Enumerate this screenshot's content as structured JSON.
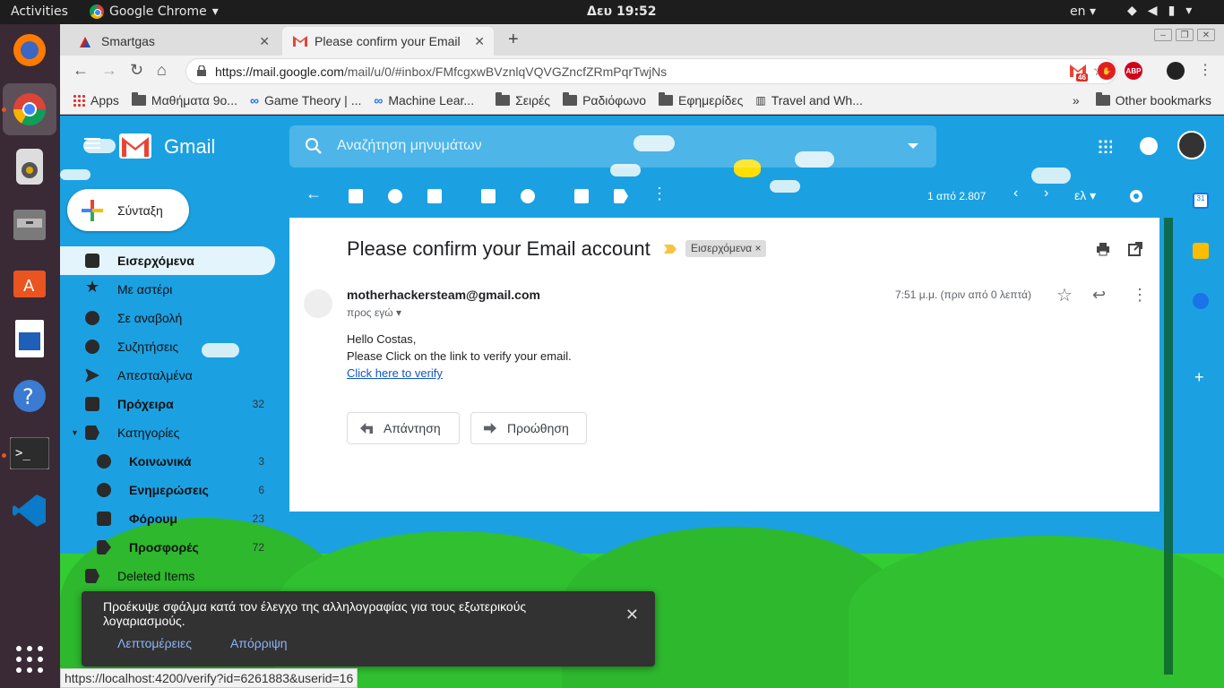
{
  "topbar": {
    "activities": "Activities",
    "app_name": "Google Chrome",
    "clock": "Δευ 19:52",
    "lang": "en"
  },
  "dock": {
    "items": [
      "firefox-icon",
      "chrome-icon",
      "speaker-icon",
      "files-icon",
      "software-icon",
      "writer-icon",
      "help-icon",
      "terminal-icon",
      "vscode-icon",
      "show-apps-icon"
    ]
  },
  "browser": {
    "tabs": [
      {
        "label": "Smartgas",
        "active": false
      },
      {
        "label": "Please confirm your Email",
        "active": true
      }
    ],
    "url_host": "https://mail.google.com",
    "url_path": "/mail/u/0/#inbox/FMfcgxwBVznlqVQVGZncfZRmPqrTwjNs",
    "gmail_ext_badge": "46",
    "abp_label": "ABP",
    "bookmarks": [
      "Apps",
      "Μαθήματα 9ο...",
      "Game Theory | ...",
      "Machine Lear...",
      "Σειρές",
      "Ραδιόφωνο",
      "Εφημερίδες",
      "Travel and Wh..."
    ],
    "bookmarks_overflow": "»",
    "other_bookmarks": "Other bookmarks",
    "status_url": "https://localhost:4200/verify?id=6261883&userid=16"
  },
  "gmail": {
    "title": "Gmail",
    "search_placeholder": "Αναζήτηση μηνυμάτων",
    "compose": "Σύνταξη",
    "nav": [
      {
        "label": "Εισερχόμενα",
        "count": "",
        "selected": true
      },
      {
        "label": "Με αστέρι",
        "count": ""
      },
      {
        "label": "Σε αναβολή",
        "count": ""
      },
      {
        "label": "Συζητήσεις",
        "count": ""
      },
      {
        "label": "Απεσταλμένα",
        "count": ""
      },
      {
        "label": "Πρόχειρα",
        "count": "32"
      },
      {
        "label": "Κατηγορίες",
        "count": ""
      },
      {
        "label": "Κοινωνικά",
        "count": "3"
      },
      {
        "label": "Ενημερώσεις",
        "count": "6"
      },
      {
        "label": "Φόρουμ",
        "count": "23"
      },
      {
        "label": "Προσφορές",
        "count": "72"
      },
      {
        "label": "Deleted Items",
        "count": ""
      }
    ],
    "pager": "1 από 2.807",
    "lang_selector": "ελ",
    "calendar_day": "31",
    "message": {
      "subject": "Please confirm your Email account",
      "label_chip": "Εισερχόμενα",
      "sender": "motherhackersteam@gmail.com",
      "recipient": "προς εγώ",
      "time": "7:51 μ.μ. (πριν από 0 λεπτά)",
      "greeting": "Hello Costas,",
      "line": "Please Click on the link to verify your email.",
      "link_text": "Click here to verify",
      "reply": "Απάντηση",
      "forward": "Προώθηση"
    },
    "snackbar": {
      "message": "Προέκυψε σφάλμα κατά τον έλεγχο της αλληλογραφίας για τους εξωτερικούς λογαριασμούς.",
      "details": "Λεπτομέρειες",
      "dismiss": "Απόρριψη"
    }
  },
  "colors": {
    "theme_sky": "#1ba1e2",
    "theme_grass": "#33cc33",
    "gmail_red": "#ea4335",
    "ubuntu_orange": "#e95420"
  }
}
